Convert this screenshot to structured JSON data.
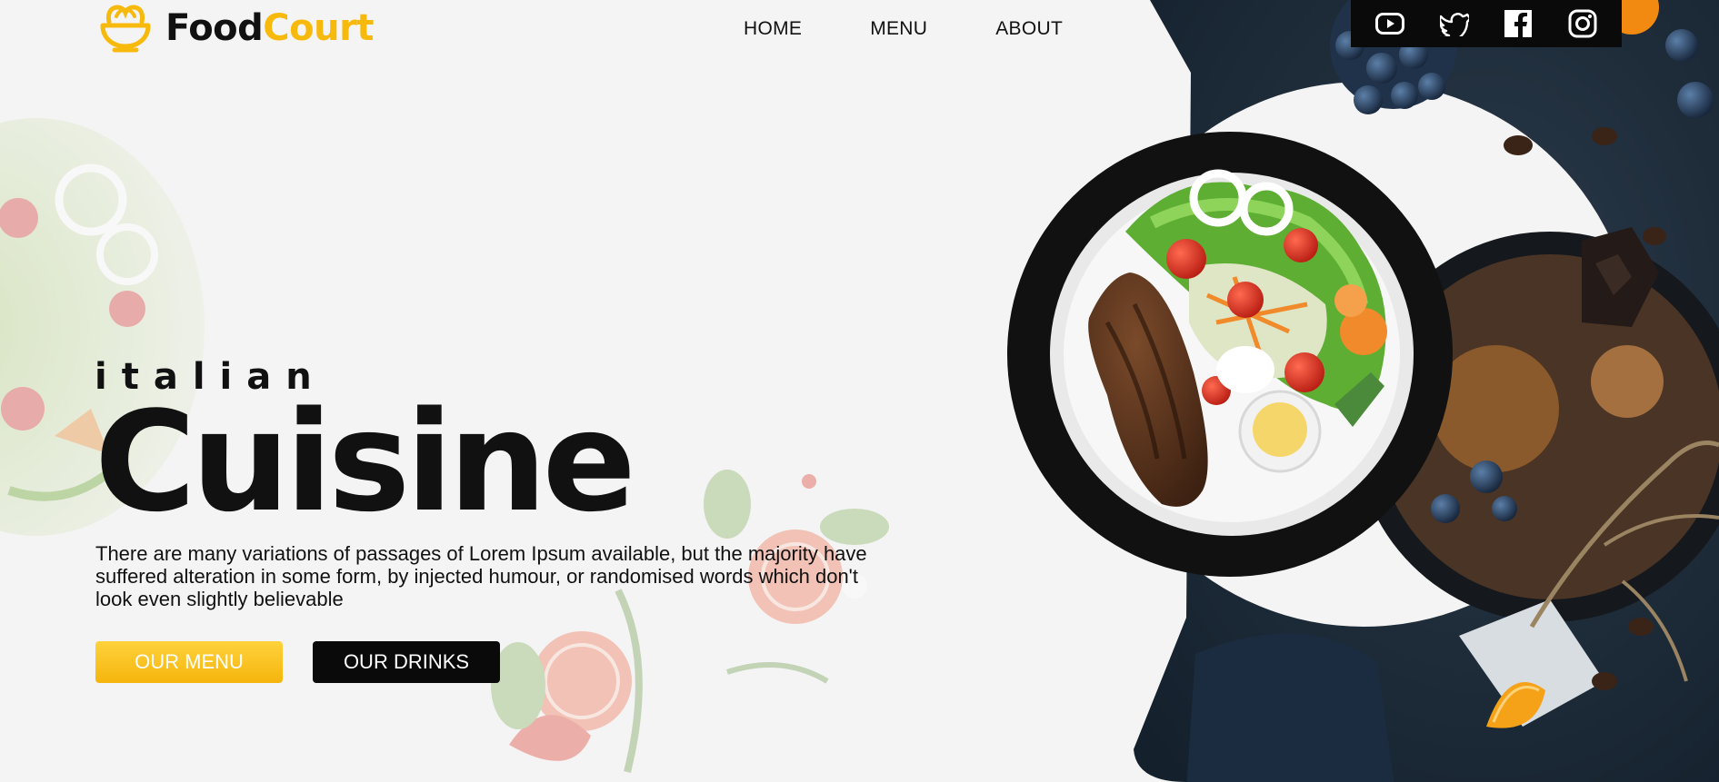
{
  "brand": {
    "part1": "Food",
    "part2": "Court",
    "accent_color": "#f7b90b"
  },
  "nav": {
    "items": [
      "HOME",
      "MENU",
      "ABOUT"
    ]
  },
  "social": [
    "youtube-icon",
    "twitter-icon",
    "facebook-icon",
    "instagram-icon"
  ],
  "hero": {
    "kicker": "italian",
    "title": "Cuisine",
    "description": "There are many variations of passages of Lorem Ipsum available, but the majority have suffered alteration in some form, by injected humour, or randomised words which don't look even slightly believable"
  },
  "buttons": {
    "menu": "OUR MENU",
    "drinks": "OUR DRINKS"
  }
}
